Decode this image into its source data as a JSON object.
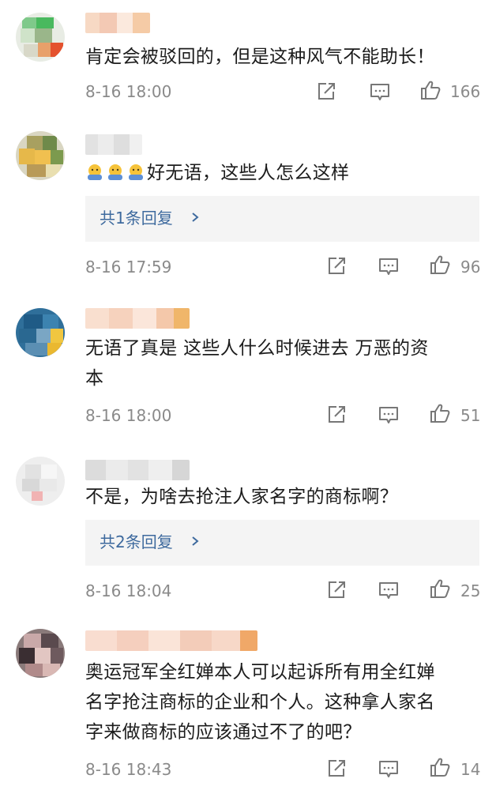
{
  "comments": [
    {
      "text": "肯定会被驳回的，但是这种风气不能助长！",
      "time": "8-16 18:00",
      "likes": "166"
    },
    {
      "text": "好无语，这些人怎么这样",
      "emoji": [
        "emoji-icon",
        "emoji-icon",
        "emoji-icon"
      ],
      "reply_label": "共1条回复",
      "time": "8-16 17:59",
      "likes": "96"
    },
    {
      "text_line1": "无语了真是 这些人什么时候进去 万恶的资",
      "text_line2": "本",
      "time": "8-16 18:00",
      "likes": "51"
    },
    {
      "text": "不是，为啥去抢注人家名字的商标啊？",
      "reply_label": "共2条回复",
      "time": "8-16 18:04",
      "likes": "25"
    },
    {
      "text_line1": "奥运冠军全红婵本人可以起诉所有用全红婵",
      "text_line2": "名字抢注商标的企业和个人。这种拿人家名",
      "text_line3": "字来做商标的应该通过不了的吧？",
      "time": "8-16 18:43",
      "likes": "14"
    }
  ],
  "colors": {
    "link": "#3e6a9e",
    "meta": "#8a8a8a",
    "reply_bg": "#f4f4f4"
  },
  "icons": [
    "share-icon",
    "comment-icon",
    "like-icon",
    "chevron-right-icon"
  ]
}
